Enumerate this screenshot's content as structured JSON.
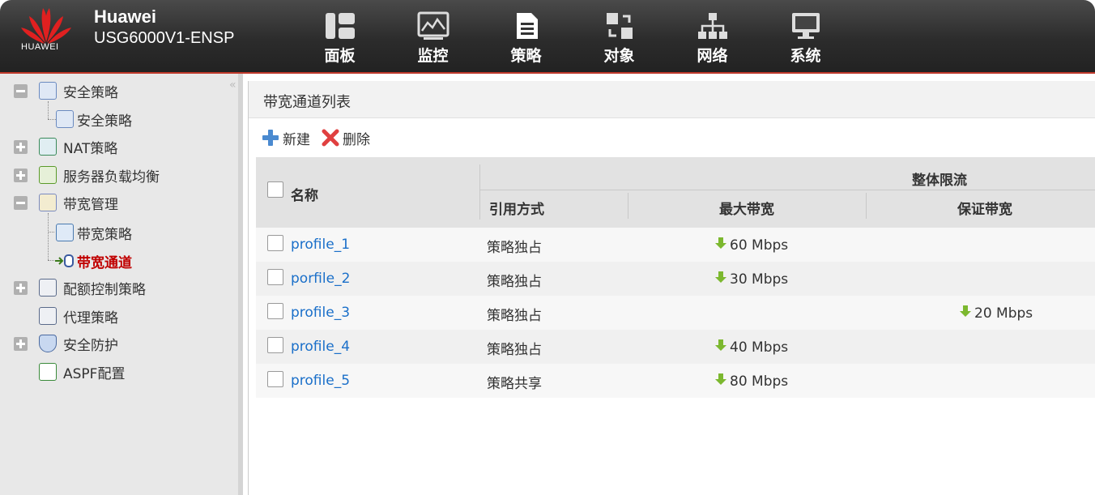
{
  "header": {
    "logo_text": "HUAWEI",
    "brand": "Huawei",
    "device": "USG6000V1-ENSP",
    "nav": [
      {
        "label": "面板",
        "icon": "dashboard-icon"
      },
      {
        "label": "监控",
        "icon": "monitor-icon"
      },
      {
        "label": "策略",
        "icon": "policy-document-icon"
      },
      {
        "label": "对象",
        "icon": "objects-icon"
      },
      {
        "label": "网络",
        "icon": "network-icon"
      },
      {
        "label": "系统",
        "icon": "system-computer-icon"
      }
    ]
  },
  "sidebar": {
    "items": [
      {
        "label": "安全策略"
      },
      {
        "label": "安全策略"
      },
      {
        "label": "NAT策略"
      },
      {
        "label": "服务器负载均衡"
      },
      {
        "label": "带宽管理"
      },
      {
        "label": "带宽策略"
      },
      {
        "label": "带宽通道"
      },
      {
        "label": "配额控制策略"
      },
      {
        "label": "代理策略"
      },
      {
        "label": "安全防护"
      },
      {
        "label": "ASPF配置"
      }
    ]
  },
  "panel": {
    "title": "带宽通道列表",
    "toolbar": {
      "new_label": "新建",
      "delete_label": "删除"
    }
  },
  "table": {
    "headers": {
      "name": "名称",
      "overall_limit": "整体限流",
      "reference_mode": "引用方式",
      "max_bandwidth": "最大带宽",
      "guaranteed_bandwidth": "保证带宽"
    },
    "rows": [
      {
        "name": "profile_1",
        "mode": "策略独占",
        "max": "60 Mbps",
        "guaranteed": ""
      },
      {
        "name": "porfile_2",
        "mode": "策略独占",
        "max": "30 Mbps",
        "guaranteed": ""
      },
      {
        "name": "profile_3",
        "mode": "策略独占",
        "max": "",
        "guaranteed": "20 Mbps"
      },
      {
        "name": "profile_4",
        "mode": "策略独占",
        "max": "40 Mbps",
        "guaranteed": ""
      },
      {
        "name": "profile_5",
        "mode": "策略共享",
        "max": "80 Mbps",
        "guaranteed": ""
      }
    ]
  },
  "colors": {
    "accent_red": "#c00000",
    "link_blue": "#1a6fc9",
    "arrow_green": "#7cb82f"
  }
}
